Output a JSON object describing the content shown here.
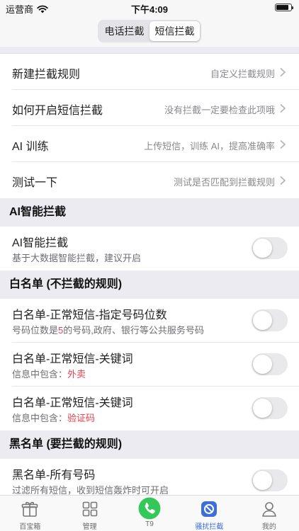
{
  "status_bar": {
    "carrier": "运营商",
    "time": "下午4:09",
    "battery_level": 0.85
  },
  "segment": {
    "tabs": [
      {
        "label": "电话拦截",
        "active": false
      },
      {
        "label": "短信拦截",
        "active": true
      }
    ]
  },
  "rules": [
    {
      "title": "新建拦截规则",
      "detail": "自定义拦截规则"
    },
    {
      "title": "如何开启短信拦截",
      "detail": "没有拦截一定要检查此项哦"
    },
    {
      "title": "AI 训练",
      "detail": "上传短信，训练 AI，提高准确率"
    },
    {
      "title": "测试一下",
      "detail": "测试是否匹配到拦截规则"
    }
  ],
  "ai_section": {
    "header": "AI智能拦截",
    "item": {
      "title": "AI智能拦截",
      "subtitle": "基于大数据智能拦截，建议开启",
      "on": false
    }
  },
  "whitelist": {
    "header": "白名单 (不拦截的规则)",
    "items": [
      {
        "title": "白名单-正常短信-指定号码位数",
        "sub_prefix": "号码位数是",
        "sub_highlight": "5",
        "sub_suffix": "的号码,政府、银行等公共服务号码",
        "on": false
      },
      {
        "title": "白名单-正常短信-关键词",
        "sub_prefix": "信息中包含：",
        "sub_highlight": "外卖",
        "sub_suffix": "",
        "on": false
      },
      {
        "title": "白名单-正常短信-关键词",
        "sub_prefix": "信息中包含：",
        "sub_highlight": "验证码",
        "sub_suffix": "",
        "on": false
      }
    ]
  },
  "blacklist": {
    "header": "黑名单 (要拦截的规则)",
    "item": {
      "title": "黑名单-所有号码",
      "subtitle": "过滤所有短信，收到短信轰炸时可开启",
      "on": false
    }
  },
  "tabbar": {
    "tabs": [
      {
        "label": "百宝箱",
        "icon": "gift-icon",
        "active": false
      },
      {
        "label": "管理",
        "icon": "grid-icon",
        "active": false
      },
      {
        "label": "T9",
        "icon": "phone-icon",
        "active": false
      },
      {
        "label": "骚扰拦截",
        "icon": "block-icon",
        "active": true
      },
      {
        "label": "我的",
        "icon": "person-icon",
        "active": false
      }
    ]
  },
  "colors": {
    "accent": "#3d6fd6",
    "highlight": "#e5404e",
    "call_green": "#34c759"
  }
}
